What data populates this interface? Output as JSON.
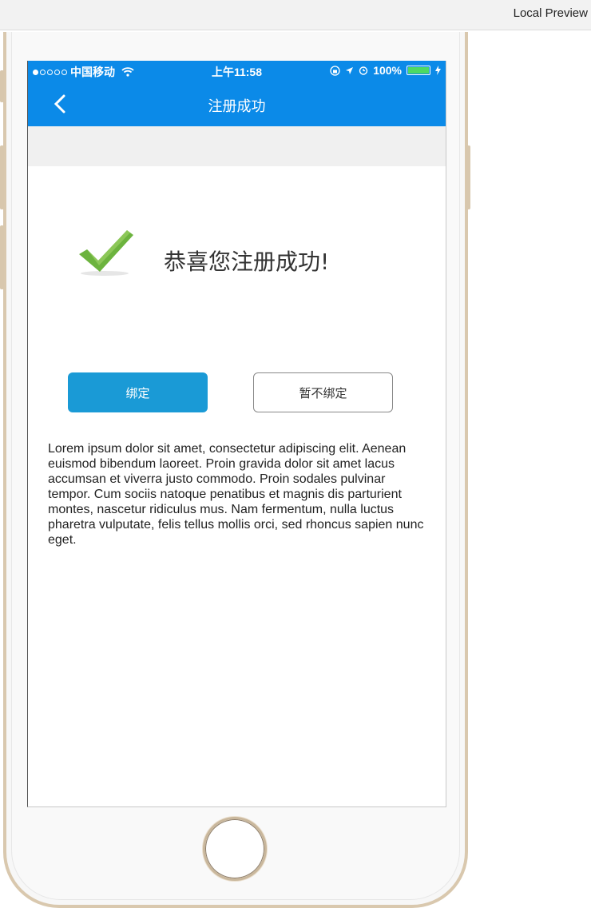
{
  "preview": {
    "title": "Local Preview"
  },
  "status_bar": {
    "carrier": "中国移动",
    "time": "上午11:58",
    "battery": "100%",
    "battery_level": 1.0
  },
  "nav": {
    "title": "注册成功",
    "back_icon": "chevron-left-icon"
  },
  "success": {
    "icon": "checkmark-icon",
    "message": "恭喜您注册成功!"
  },
  "buttons": {
    "bind_label": "绑定",
    "skip_label": "暂不绑定"
  },
  "body_text": "Lorem ipsum dolor sit amet, consectetur adipiscing elit. Aenean euismod bibendum laoreet. Proin gravida dolor sit amet lacus accumsan et viverra justo commodo. Proin sodales pulvinar tempor. Cum sociis natoque penatibus et magnis dis parturient montes, nascetur ridiculus mus. Nam fermentum, nulla luctus pharetra vulputate, felis tellus mollis orci, sed rhoncus sapien nunc eget.",
  "colors": {
    "accent": "#0b8ae8",
    "button_primary": "#1a9ad6",
    "check": "#6cb33e"
  }
}
